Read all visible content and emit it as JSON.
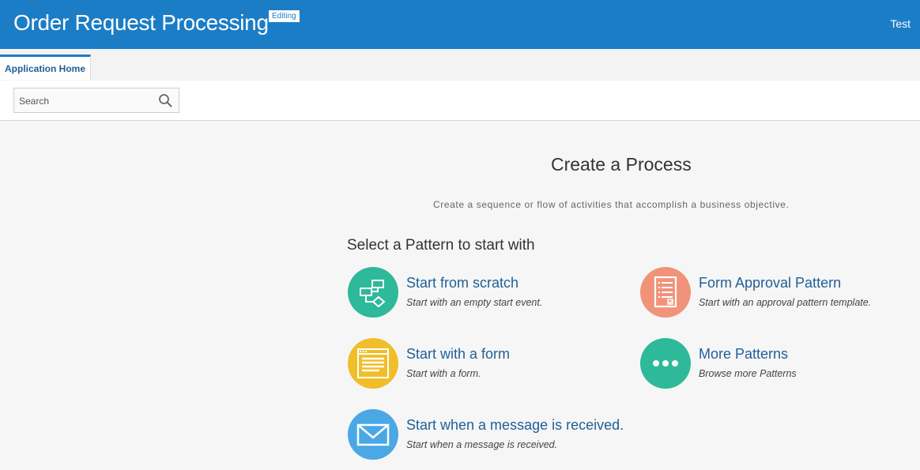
{
  "header": {
    "title": "Order Request Processing",
    "badge": "Editing",
    "user": "Test",
    "background_color": "#1b7dc6"
  },
  "tabs": [
    {
      "label": "Application Home",
      "active": true
    }
  ],
  "search": {
    "placeholder": "Search",
    "value": "",
    "icon": "search-icon"
  },
  "main": {
    "title": "Create a Process",
    "subtitle": "Create a sequence or flow of activities that accomplish a business objective.",
    "select_heading": "Select a Pattern to start with",
    "patterns": [
      {
        "title": "Start from scratch",
        "description": "Start with an empty start event.",
        "icon": "flow-diagram-icon",
        "color": "#2db99a"
      },
      {
        "title": "Form Approval Pattern",
        "description": "Start with an approval pattern template.",
        "icon": "form-checklist-icon",
        "color": "#f0937a"
      },
      {
        "title": "Start with a form",
        "description": "Start with a form.",
        "icon": "form-window-icon",
        "color": "#f0be2a"
      },
      {
        "title": "More Patterns",
        "description": "Browse more Patterns",
        "icon": "more-dots-icon",
        "color": "#2db99a"
      },
      {
        "title": "Start when a message is received.",
        "description": "Start when a message is received.",
        "icon": "envelope-icon",
        "color": "#4aa8e4"
      }
    ]
  }
}
